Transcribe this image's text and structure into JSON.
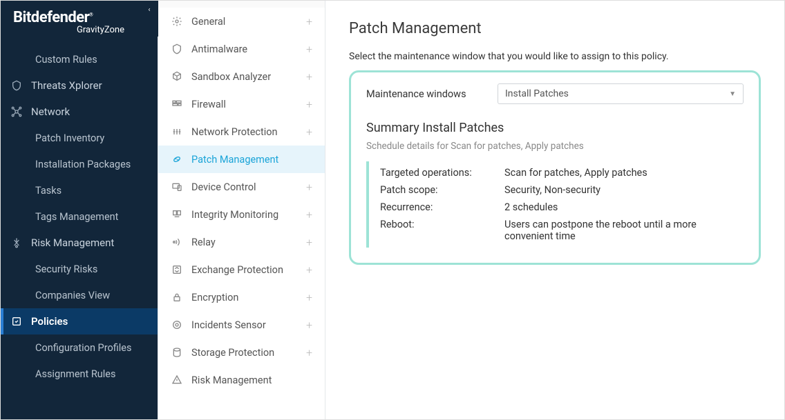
{
  "brand": {
    "name": "Bitdefender",
    "product": "GravityZone"
  },
  "sidebar": {
    "items": [
      {
        "label": "Custom Rules",
        "sub": true
      },
      {
        "label": "Threats Xplorer",
        "icon": "shield"
      },
      {
        "label": "Network",
        "icon": "network"
      },
      {
        "label": "Patch Inventory",
        "sub": true
      },
      {
        "label": "Installation Packages",
        "sub": true
      },
      {
        "label": "Tasks",
        "sub": true
      },
      {
        "label": "Tags Management",
        "sub": true
      },
      {
        "label": "Risk Management",
        "icon": "risk"
      },
      {
        "label": "Security Risks",
        "sub": true
      },
      {
        "label": "Companies View",
        "sub": true
      },
      {
        "label": "Policies",
        "icon": "policies",
        "selected": true
      },
      {
        "label": "Configuration Profiles",
        "sub": true
      },
      {
        "label": "Assignment Rules",
        "sub": true
      }
    ]
  },
  "menu": {
    "items": [
      {
        "label": "General",
        "icon": "gear"
      },
      {
        "label": "Antimalware",
        "icon": "shield2"
      },
      {
        "label": "Sandbox Analyzer",
        "icon": "cube"
      },
      {
        "label": "Firewall",
        "icon": "firewall"
      },
      {
        "label": "Network Protection",
        "icon": "netprot"
      },
      {
        "label": "Patch Management",
        "icon": "patch",
        "active": true
      },
      {
        "label": "Device Control",
        "icon": "device"
      },
      {
        "label": "Integrity Monitoring",
        "icon": "integrity"
      },
      {
        "label": "Relay",
        "icon": "relay"
      },
      {
        "label": "Exchange Protection",
        "icon": "exchange"
      },
      {
        "label": "Encryption",
        "icon": "lock"
      },
      {
        "label": "Incidents Sensor",
        "icon": "sensor"
      },
      {
        "label": "Storage Protection",
        "icon": "storage"
      },
      {
        "label": "Risk Management",
        "icon": "riskm"
      }
    ]
  },
  "main": {
    "title": "Patch Management",
    "description": "Select the maintenance window that you would like to assign to this policy.",
    "mw_label": "Maintenance windows",
    "mw_value": "Install Patches",
    "summary_title": "Summary Install Patches",
    "summary_sub": "Schedule details for Scan for patches, Apply patches",
    "rows": [
      {
        "key": "Targeted operations:",
        "val": "Scan for patches, Apply patches"
      },
      {
        "key": "Patch scope:",
        "val": "Security, Non-security"
      },
      {
        "key": "Recurrence:",
        "val": "2 schedules"
      },
      {
        "key": "Reboot:",
        "val": "Users can postpone the reboot until a more convenient time"
      }
    ]
  }
}
